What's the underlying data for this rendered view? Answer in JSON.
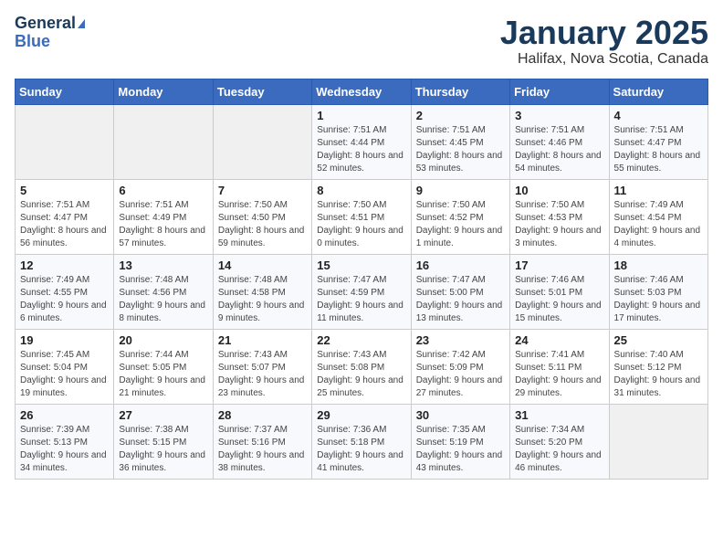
{
  "header": {
    "logo_line1": "General",
    "logo_line2": "Blue",
    "title": "January 2025",
    "subtitle": "Halifax, Nova Scotia, Canada"
  },
  "days_of_week": [
    "Sunday",
    "Monday",
    "Tuesday",
    "Wednesday",
    "Thursday",
    "Friday",
    "Saturday"
  ],
  "weeks": [
    [
      {
        "num": "",
        "info": ""
      },
      {
        "num": "",
        "info": ""
      },
      {
        "num": "",
        "info": ""
      },
      {
        "num": "1",
        "info": "Sunrise: 7:51 AM\nSunset: 4:44 PM\nDaylight: 8 hours and 52 minutes."
      },
      {
        "num": "2",
        "info": "Sunrise: 7:51 AM\nSunset: 4:45 PM\nDaylight: 8 hours and 53 minutes."
      },
      {
        "num": "3",
        "info": "Sunrise: 7:51 AM\nSunset: 4:46 PM\nDaylight: 8 hours and 54 minutes."
      },
      {
        "num": "4",
        "info": "Sunrise: 7:51 AM\nSunset: 4:47 PM\nDaylight: 8 hours and 55 minutes."
      }
    ],
    [
      {
        "num": "5",
        "info": "Sunrise: 7:51 AM\nSunset: 4:47 PM\nDaylight: 8 hours and 56 minutes."
      },
      {
        "num": "6",
        "info": "Sunrise: 7:51 AM\nSunset: 4:49 PM\nDaylight: 8 hours and 57 minutes."
      },
      {
        "num": "7",
        "info": "Sunrise: 7:50 AM\nSunset: 4:50 PM\nDaylight: 8 hours and 59 minutes."
      },
      {
        "num": "8",
        "info": "Sunrise: 7:50 AM\nSunset: 4:51 PM\nDaylight: 9 hours and 0 minutes."
      },
      {
        "num": "9",
        "info": "Sunrise: 7:50 AM\nSunset: 4:52 PM\nDaylight: 9 hours and 1 minute."
      },
      {
        "num": "10",
        "info": "Sunrise: 7:50 AM\nSunset: 4:53 PM\nDaylight: 9 hours and 3 minutes."
      },
      {
        "num": "11",
        "info": "Sunrise: 7:49 AM\nSunset: 4:54 PM\nDaylight: 9 hours and 4 minutes."
      }
    ],
    [
      {
        "num": "12",
        "info": "Sunrise: 7:49 AM\nSunset: 4:55 PM\nDaylight: 9 hours and 6 minutes."
      },
      {
        "num": "13",
        "info": "Sunrise: 7:48 AM\nSunset: 4:56 PM\nDaylight: 9 hours and 8 minutes."
      },
      {
        "num": "14",
        "info": "Sunrise: 7:48 AM\nSunset: 4:58 PM\nDaylight: 9 hours and 9 minutes."
      },
      {
        "num": "15",
        "info": "Sunrise: 7:47 AM\nSunset: 4:59 PM\nDaylight: 9 hours and 11 minutes."
      },
      {
        "num": "16",
        "info": "Sunrise: 7:47 AM\nSunset: 5:00 PM\nDaylight: 9 hours and 13 minutes."
      },
      {
        "num": "17",
        "info": "Sunrise: 7:46 AM\nSunset: 5:01 PM\nDaylight: 9 hours and 15 minutes."
      },
      {
        "num": "18",
        "info": "Sunrise: 7:46 AM\nSunset: 5:03 PM\nDaylight: 9 hours and 17 minutes."
      }
    ],
    [
      {
        "num": "19",
        "info": "Sunrise: 7:45 AM\nSunset: 5:04 PM\nDaylight: 9 hours and 19 minutes."
      },
      {
        "num": "20",
        "info": "Sunrise: 7:44 AM\nSunset: 5:05 PM\nDaylight: 9 hours and 21 minutes."
      },
      {
        "num": "21",
        "info": "Sunrise: 7:43 AM\nSunset: 5:07 PM\nDaylight: 9 hours and 23 minutes."
      },
      {
        "num": "22",
        "info": "Sunrise: 7:43 AM\nSunset: 5:08 PM\nDaylight: 9 hours and 25 minutes."
      },
      {
        "num": "23",
        "info": "Sunrise: 7:42 AM\nSunset: 5:09 PM\nDaylight: 9 hours and 27 minutes."
      },
      {
        "num": "24",
        "info": "Sunrise: 7:41 AM\nSunset: 5:11 PM\nDaylight: 9 hours and 29 minutes."
      },
      {
        "num": "25",
        "info": "Sunrise: 7:40 AM\nSunset: 5:12 PM\nDaylight: 9 hours and 31 minutes."
      }
    ],
    [
      {
        "num": "26",
        "info": "Sunrise: 7:39 AM\nSunset: 5:13 PM\nDaylight: 9 hours and 34 minutes."
      },
      {
        "num": "27",
        "info": "Sunrise: 7:38 AM\nSunset: 5:15 PM\nDaylight: 9 hours and 36 minutes."
      },
      {
        "num": "28",
        "info": "Sunrise: 7:37 AM\nSunset: 5:16 PM\nDaylight: 9 hours and 38 minutes."
      },
      {
        "num": "29",
        "info": "Sunrise: 7:36 AM\nSunset: 5:18 PM\nDaylight: 9 hours and 41 minutes."
      },
      {
        "num": "30",
        "info": "Sunrise: 7:35 AM\nSunset: 5:19 PM\nDaylight: 9 hours and 43 minutes."
      },
      {
        "num": "31",
        "info": "Sunrise: 7:34 AM\nSunset: 5:20 PM\nDaylight: 9 hours and 46 minutes."
      },
      {
        "num": "",
        "info": ""
      }
    ]
  ]
}
